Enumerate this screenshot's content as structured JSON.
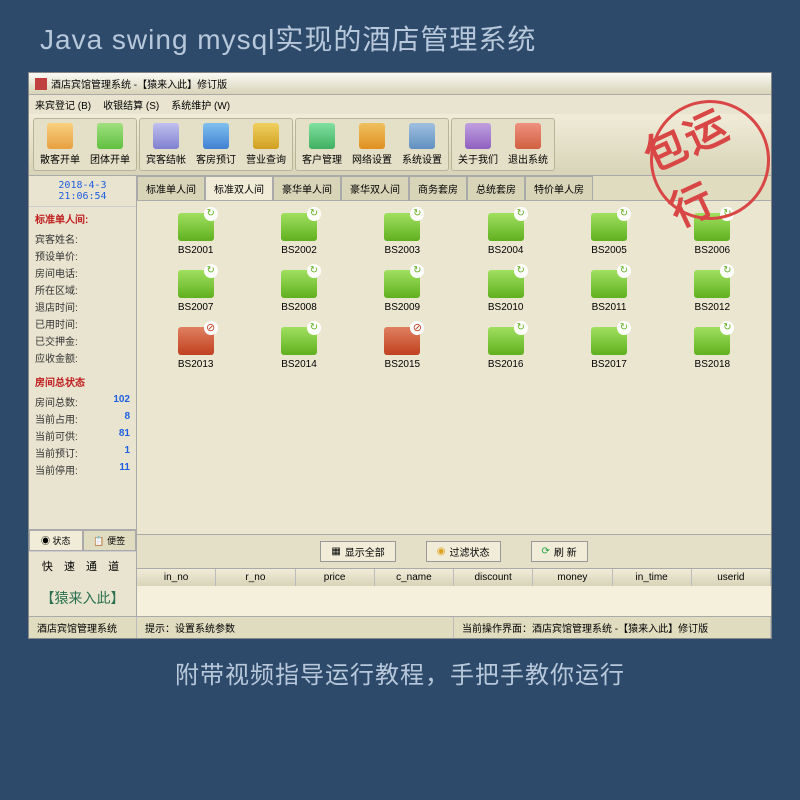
{
  "banner": {
    "top": "Java swing mysql实现的酒店管理系统",
    "bottom": "附带视频指导运行教程，手把手教你运行",
    "stamp": "包运行"
  },
  "window": {
    "title": "酒店宾馆管理系统 -【猿来入此】修订版"
  },
  "menu": {
    "items": [
      "来宾登记 (B)",
      "收银结算 (S)",
      "系统维护 (W)"
    ]
  },
  "toolbar": {
    "groups": [
      [
        {
          "label": "散客开单",
          "icon": "ic-person1"
        },
        {
          "label": "团体开单",
          "icon": "ic-person2"
        }
      ],
      [
        {
          "label": "宾客结帐",
          "icon": "ic-bill"
        },
        {
          "label": "客房预订",
          "icon": "ic-reserve"
        },
        {
          "label": "营业查询",
          "icon": "ic-query"
        }
      ],
      [
        {
          "label": "客户管理",
          "icon": "ic-cust"
        },
        {
          "label": "网络设置",
          "icon": "ic-net"
        },
        {
          "label": "系统设置",
          "icon": "ic-sys"
        }
      ],
      [
        {
          "label": "关于我们",
          "icon": "ic-about"
        },
        {
          "label": "退出系统",
          "icon": "ic-exit"
        }
      ]
    ]
  },
  "sidebar": {
    "clock": "2018-4-3 21:06:54",
    "room_info": {
      "title": "标准单人间:",
      "fields": [
        "宾客姓名:",
        "预设单价:",
        "房间电话:",
        "所在区域:",
        "退店时间:",
        "已用时间:",
        "已交押金:",
        "应收金额:"
      ]
    },
    "room_stats": {
      "title": "房间总状态",
      "rows": [
        {
          "label": "房间总数:",
          "value": "102"
        },
        {
          "label": "当前占用:",
          "value": "8"
        },
        {
          "label": "当前可供:",
          "value": "81"
        },
        {
          "label": "当前预订:",
          "value": "1"
        },
        {
          "label": "当前停用:",
          "value": "11"
        }
      ]
    },
    "tabs": [
      "◉ 状态",
      "📋 便签"
    ],
    "quick": "快 速 通 道",
    "brand": "【猿来入此】"
  },
  "room_tabs": [
    "标准单人间",
    "标准双人间",
    "豪华单人间",
    "豪华双人间",
    "商务套房",
    "总统套房",
    "特价单人房"
  ],
  "active_room_tab": 1,
  "rooms": [
    {
      "id": "BS2001",
      "status": "avail"
    },
    {
      "id": "BS2002",
      "status": "avail"
    },
    {
      "id": "BS2003",
      "status": "avail"
    },
    {
      "id": "BS2004",
      "status": "avail"
    },
    {
      "id": "BS2005",
      "status": "avail"
    },
    {
      "id": "BS2006",
      "status": "avail"
    },
    {
      "id": "BS2007",
      "status": "avail"
    },
    {
      "id": "BS2008",
      "status": "avail"
    },
    {
      "id": "BS2009",
      "status": "avail"
    },
    {
      "id": "BS2010",
      "status": "avail"
    },
    {
      "id": "BS2011",
      "status": "avail"
    },
    {
      "id": "BS2012",
      "status": "avail"
    },
    {
      "id": "BS2013",
      "status": "occ"
    },
    {
      "id": "BS2014",
      "status": "avail"
    },
    {
      "id": "BS2015",
      "status": "occ"
    },
    {
      "id": "BS2016",
      "status": "avail"
    },
    {
      "id": "BS2017",
      "status": "avail"
    },
    {
      "id": "BS2018",
      "status": "avail"
    }
  ],
  "filters": {
    "show_all": "显示全部",
    "filter_status": "过滤状态",
    "refresh": "刷  新"
  },
  "table": {
    "columns": [
      "in_no",
      "r_no",
      "price",
      "c_name",
      "discount",
      "money",
      "in_time",
      "userid"
    ]
  },
  "statusbar": {
    "left": "酒店宾馆管理系统",
    "hint": "提示：设置系统参数",
    "context": "当前操作界面：酒店宾馆管理系统 -【猿来入此】修订版"
  }
}
